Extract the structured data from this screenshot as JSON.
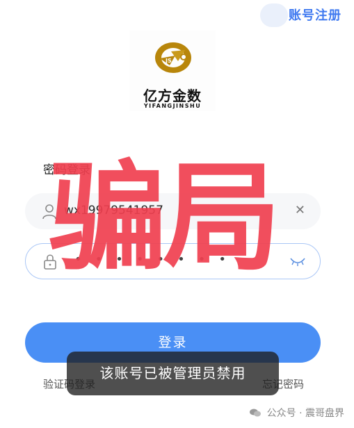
{
  "header": {
    "register_label": "账号注册"
  },
  "logo": {
    "name": "亿方金数",
    "sub": "YIFANGJINSHU",
    "monogram": "JS"
  },
  "login_form": {
    "title": "密码登录",
    "username_value": "wx19979541957",
    "password_mask": "••••••••",
    "login_label": "登录",
    "sms_login_label": "验证码登录",
    "forgot_password_label": "忘记密码"
  },
  "overlay": {
    "scam_text": "骗局"
  },
  "toast": {
    "message": "该账号已被管理员禁用"
  },
  "watermark": {
    "text": "公众号 · 震哥盘界"
  },
  "colors": {
    "accent": "#4a8ff5",
    "link": "#3f79f0",
    "scam": "#f04050",
    "logo_gold": "#b8860b"
  },
  "icons": {
    "user": "user-icon",
    "lock": "lock-icon",
    "clear": "clear-icon",
    "eye": "eye-closed-icon",
    "wechat": "wechat-icon"
  }
}
